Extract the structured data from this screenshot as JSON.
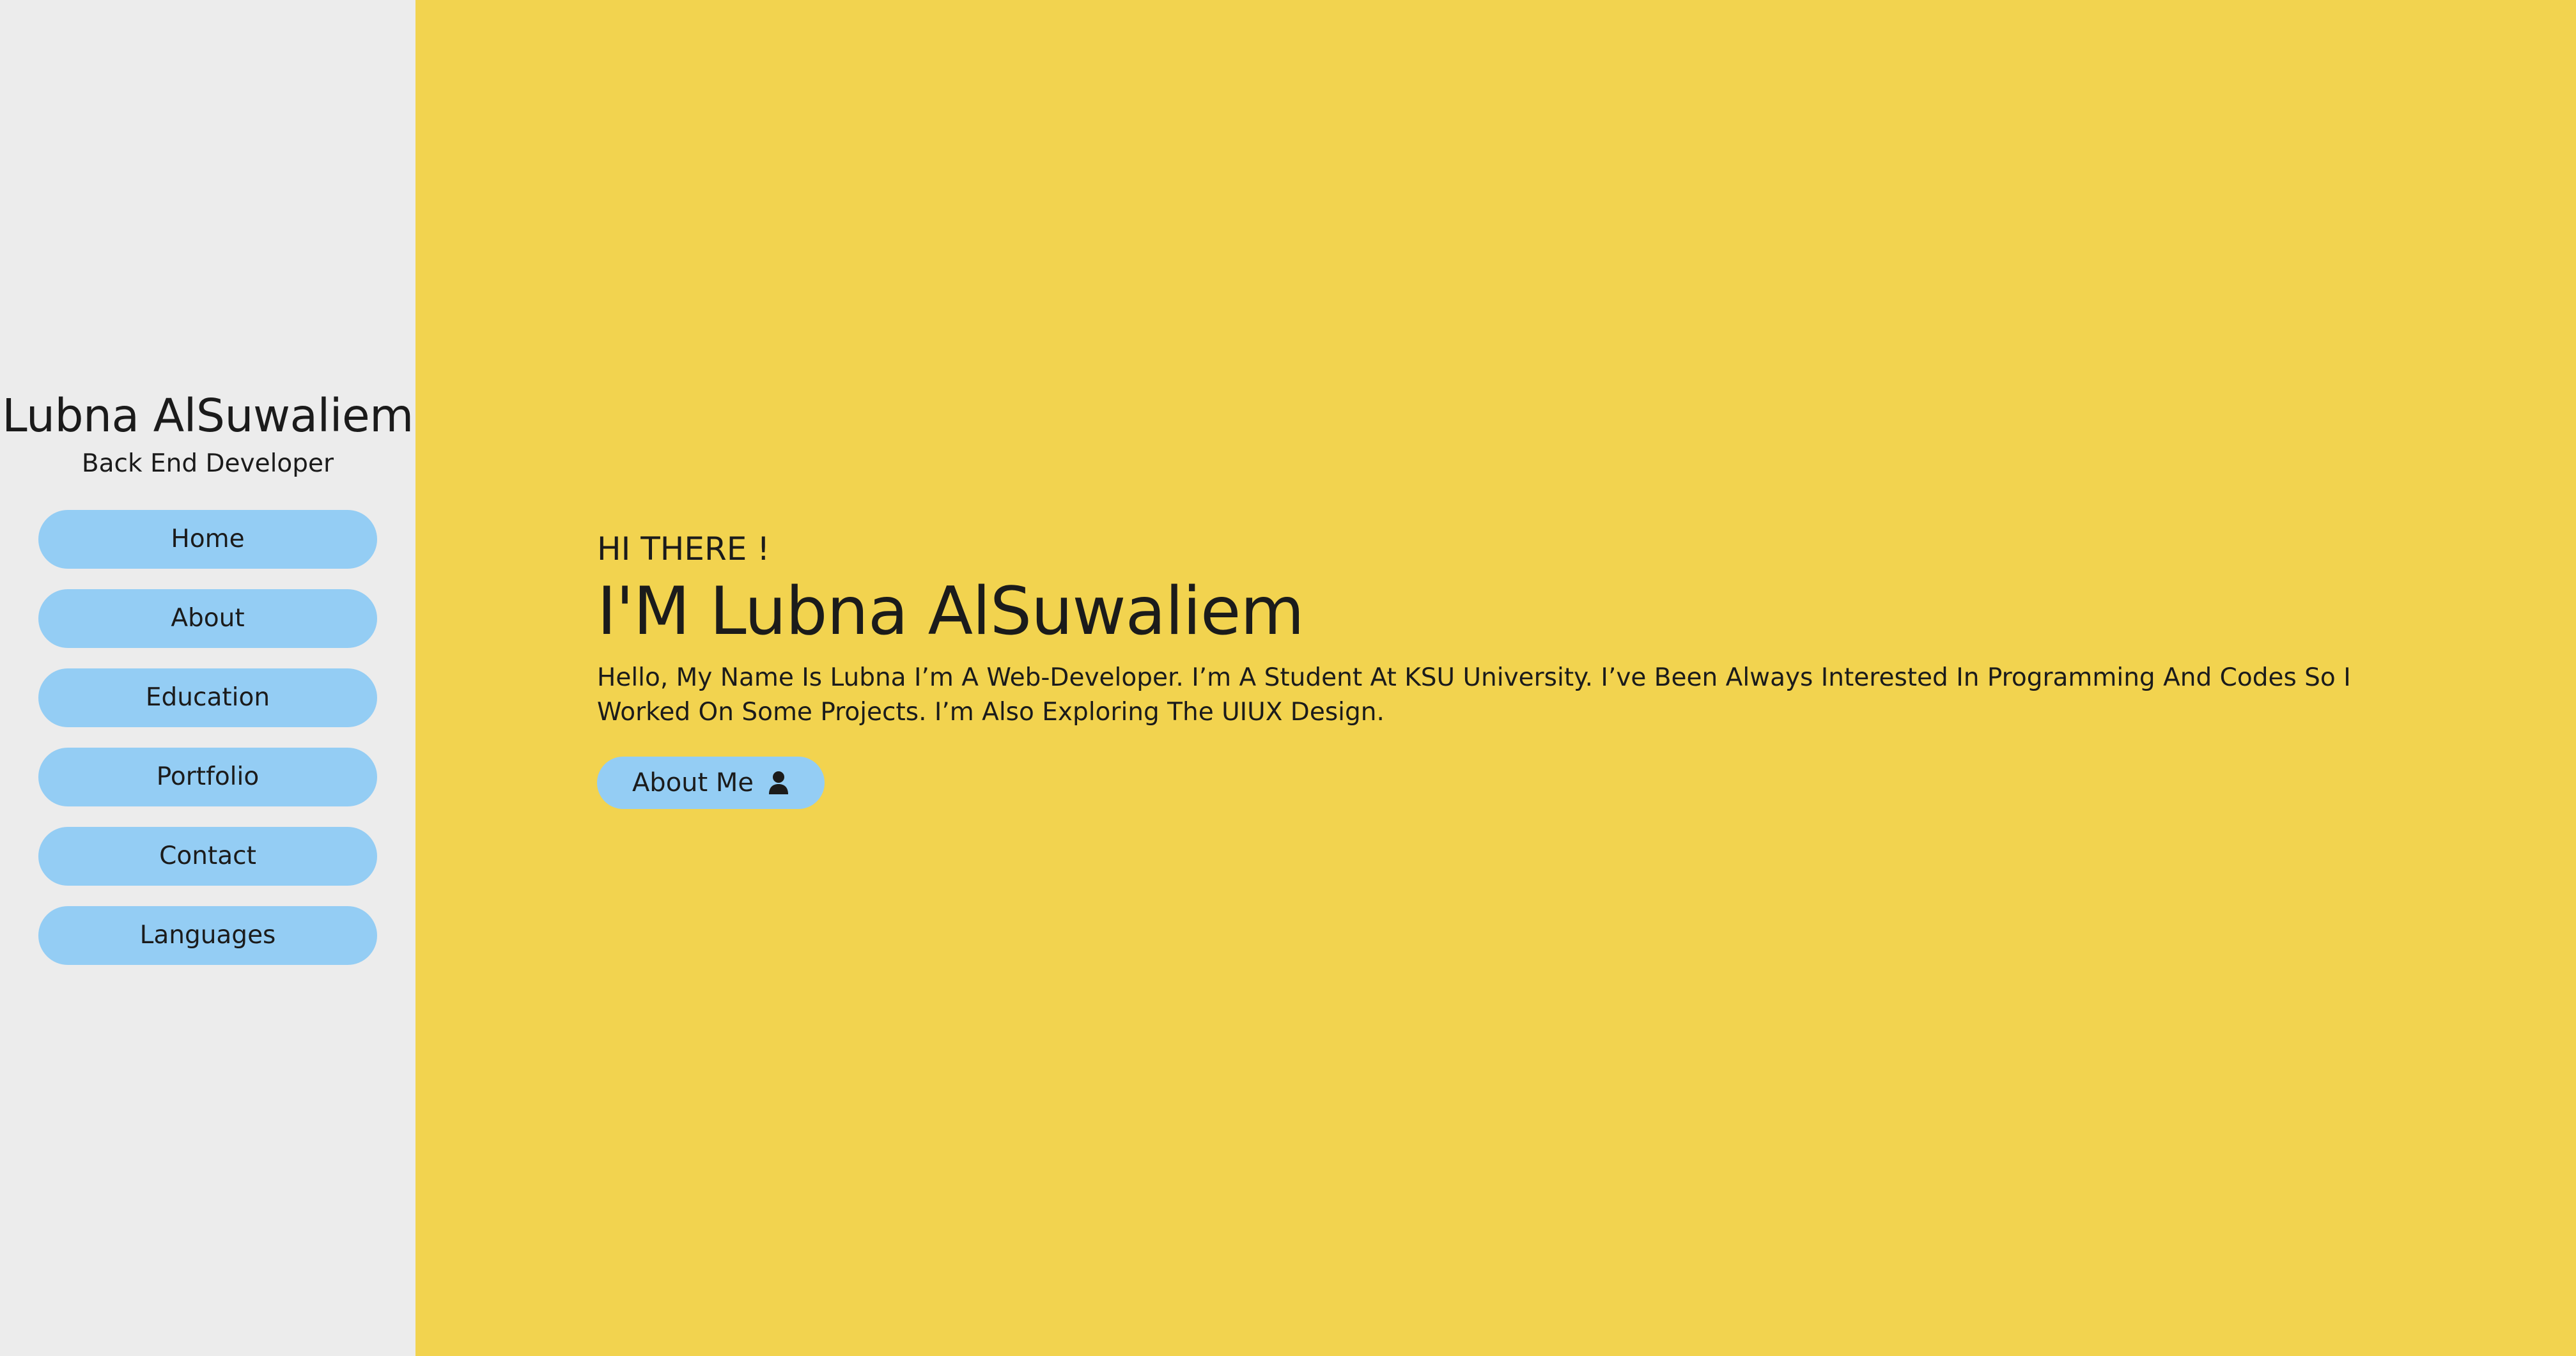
{
  "sidebar": {
    "name": "Lubna AlSuwaliem",
    "role": "Back End Developer",
    "nav": [
      {
        "label": "Home"
      },
      {
        "label": "About"
      },
      {
        "label": "Education"
      },
      {
        "label": "Portfolio"
      },
      {
        "label": "Contact"
      },
      {
        "label": "Languages"
      }
    ]
  },
  "hero": {
    "greeting": "HI THERE !",
    "title": "I'M Lubna AlSuwaliem",
    "intro": "Hello, My Name Is Lubna I’m A Web-Developer. I’m A Student At KSU University. I’ve Been Always Interested In Programming And Codes So I Worked On Some Projects. I’m Also Exploring The UIUX Design.",
    "cta_label": "About Me",
    "cta_icon": "user-icon"
  },
  "colors": {
    "sidebar_bg": "#ececec",
    "main_bg": "#f2d34f",
    "button_bg": "#94cdf4"
  }
}
